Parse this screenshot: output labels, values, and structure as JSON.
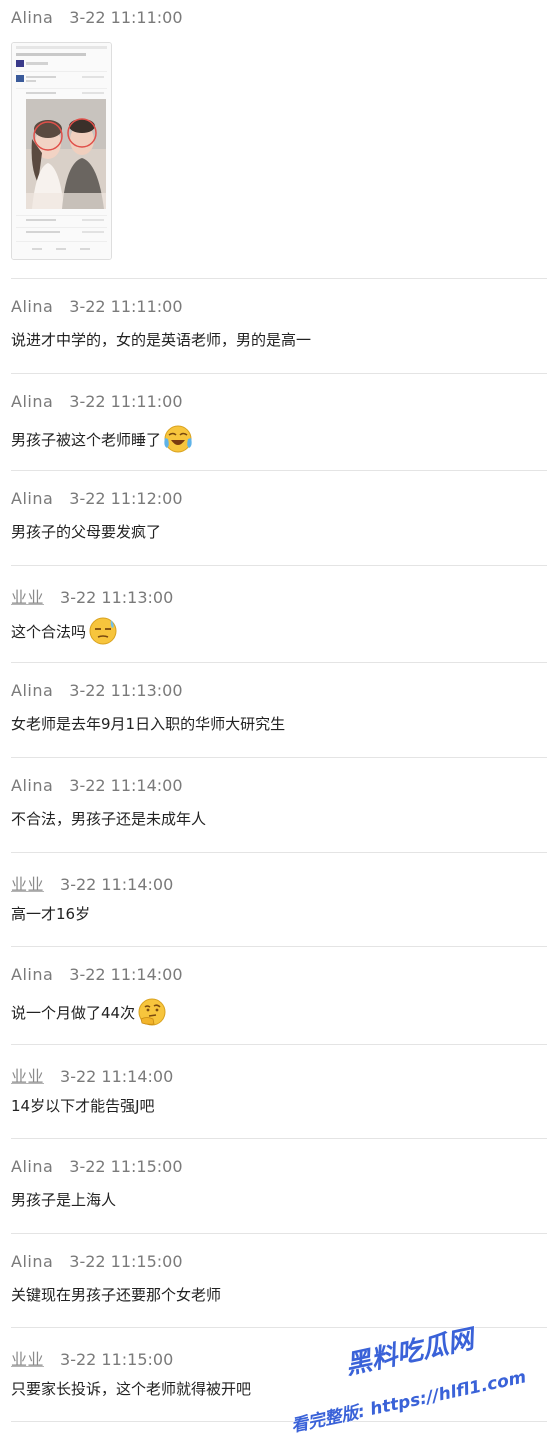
{
  "messages": [
    {
      "sender": "Alina",
      "time": "3-22 11:11:00",
      "text": "",
      "kind": "image"
    },
    {
      "sender": "Alina",
      "time": "3-22 11:11:00",
      "text": "说进才中学的，女的是英语老师，男的是高一"
    },
    {
      "sender": "Alina",
      "time": "3-22 11:11:00",
      "text": "男孩子被这个老师睡了",
      "emoji": "laughing-crying-emoji"
    },
    {
      "sender": "Alina",
      "time": "3-22 11:12:00",
      "text": "男孩子的父母要发疯了"
    },
    {
      "sender": "业业",
      "time": "3-22 11:13:00",
      "text": "这个合法吗",
      "emoji": "unamused-sweat-emoji"
    },
    {
      "sender": "Alina",
      "time": "3-22 11:13:00",
      "text": "女老师是去年9月1日入职的华师大研究生"
    },
    {
      "sender": "Alina",
      "time": "3-22 11:14:00",
      "text": "不合法，男孩子还是未成年人"
    },
    {
      "sender": "业业",
      "time": "3-22 11:14:00",
      "text": "高一才16岁"
    },
    {
      "sender": "Alina",
      "time": "3-22 11:14:00",
      "text": "说一个月做了44次",
      "emoji": "thinking-emoji"
    },
    {
      "sender": "业业",
      "time": "3-22 11:14:00",
      "text": "14岁以下才能告强J吧"
    },
    {
      "sender": "Alina",
      "time": "3-22 11:15:00",
      "text": "男孩子是上海人"
    },
    {
      "sender": "Alina",
      "time": "3-22 11:15:00",
      "text": "关键现在男孩子还要那个女老师"
    },
    {
      "sender": "业业",
      "time": "3-22 11:15:00",
      "text": "只要家长投诉，这个老师就得被开吧"
    }
  ],
  "watermark": {
    "line1": "黑料吃瓜网",
    "line2": "看完整版: https://hlfl1.com"
  },
  "colors": {
    "meta": "#7a7a7a",
    "text": "#222222",
    "divider": "#e4e4e4",
    "watermark": "#3a62d8"
  }
}
